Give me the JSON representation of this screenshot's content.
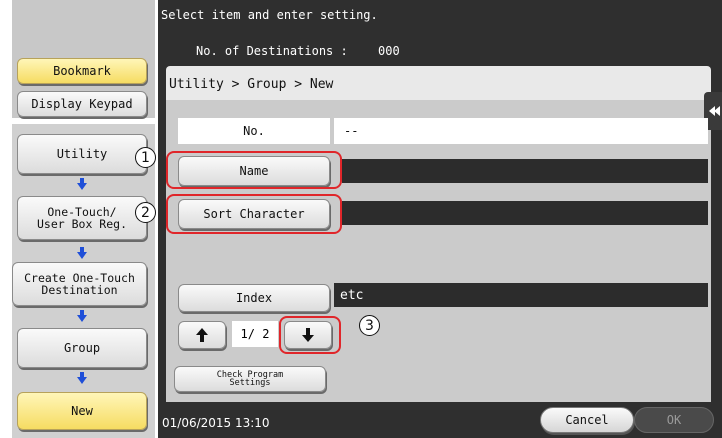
{
  "header": {
    "instruction": "Select item and enter setting.",
    "destinations_label": "No. of Destinations :",
    "destinations_value": "000"
  },
  "sidebar": {
    "bookmark": "Bookmark",
    "display_keypad": "Display Keypad",
    "steps": [
      {
        "label": "Utility"
      },
      {
        "label": "One-Touch/\nUser Box Reg."
      },
      {
        "label": "Create One-Touch\nDestination"
      },
      {
        "label": "Group"
      },
      {
        "label": "New"
      }
    ]
  },
  "breadcrumb": "Utility > Group > New",
  "form": {
    "no_label": "No.",
    "no_value": "--",
    "name_label": "Name",
    "name_value": "",
    "sort_label": "Sort Character",
    "sort_value": "",
    "index_label": "Index",
    "index_value": "etc",
    "page_indicator": "1/ 2",
    "check_program": "Check Program\nSettings"
  },
  "callouts": [
    "1",
    "2",
    "3"
  ],
  "footer": {
    "datetime": "01/06/2015  13:10",
    "cancel": "Cancel",
    "ok": "OK"
  },
  "colors": {
    "highlight_outline": "#e0262a",
    "active_button": "#f6dc62",
    "dark_background": "#2f2f2f",
    "arrow_blue": "#1f4fd8"
  },
  "icons": [
    "arrow-down-icon",
    "arrow-up-icon",
    "collapse-arrow-icon"
  ]
}
